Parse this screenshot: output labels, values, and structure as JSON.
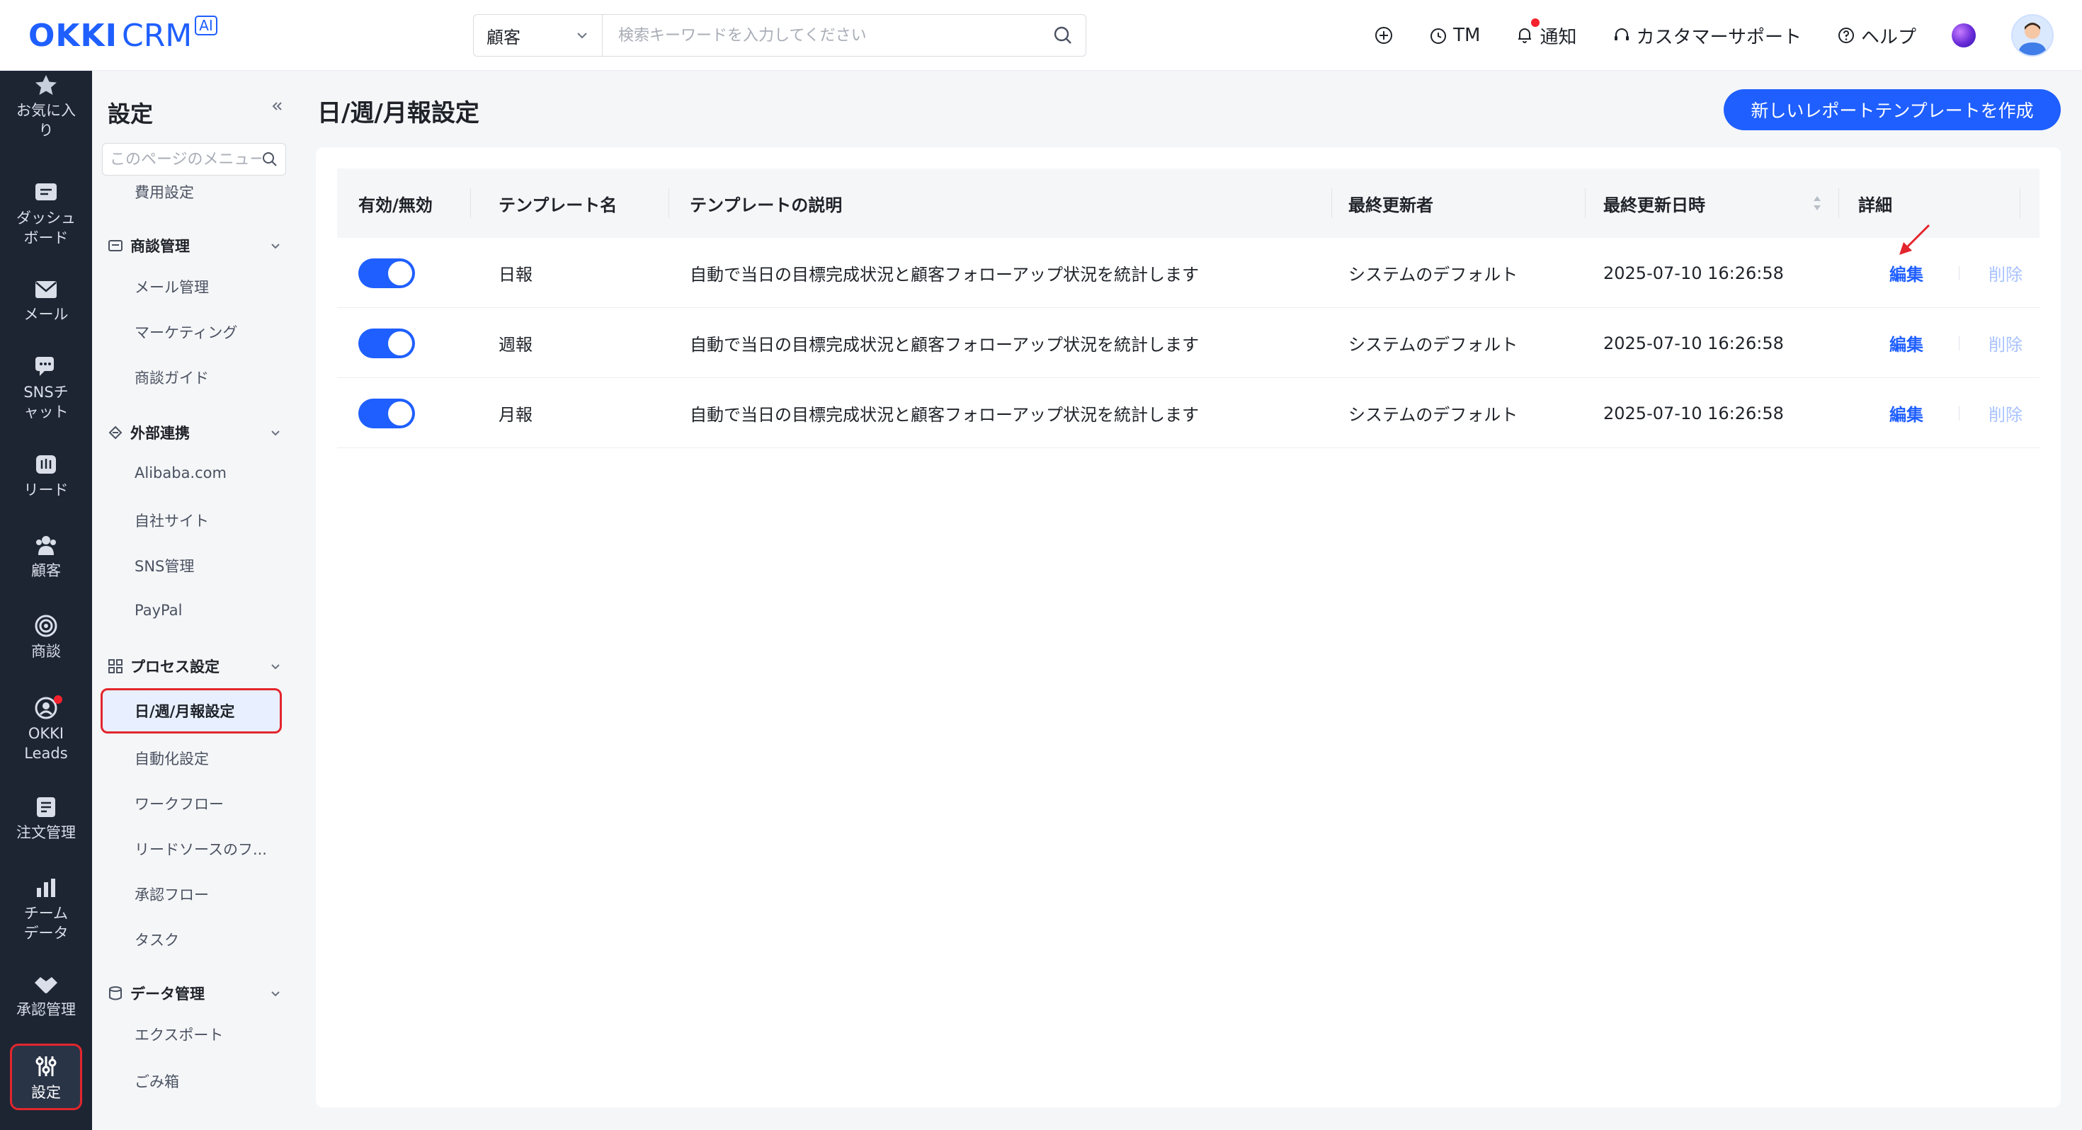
{
  "brand": {
    "logo_main": "OKKI",
    "logo_sub": "CRM",
    "logo_badge": "AI"
  },
  "search": {
    "type": "顧客",
    "placeholder": "検索キーワードを入力してください"
  },
  "top_actions": {
    "tm": "TM",
    "notify": "通知",
    "support": "カスタマーサポート",
    "help": "ヘルプ"
  },
  "leftnav": {
    "favorites": "お気に入り",
    "dashboard": "ダッシュボード",
    "mail": "メール",
    "sns_chat": "SNSチャット",
    "leads": "リード",
    "customers": "顧客",
    "deals": "商談",
    "okki_leads": "OKKI Leads",
    "orders": "注文管理",
    "team_data": "チームデータ",
    "approvals": "承認管理",
    "settings": "設定"
  },
  "sidebar": {
    "title": "設定",
    "search_placeholder": "このページのメニュー",
    "cost_settings": "費用設定",
    "groups": {
      "deals": "商談管理",
      "external": "外部連携",
      "process": "プロセス設定",
      "data": "データ管理"
    },
    "items": {
      "mail_mgmt": "メール管理",
      "marketing": "マーケティング",
      "deal_guide": "商談ガイド",
      "alibaba": "Alibaba.com",
      "own_site": "自社サイト",
      "sns_mgmt": "SNS管理",
      "paypal": "PayPal",
      "report_settings": "日/週/月報設定",
      "automation": "自動化設定",
      "workflow": "ワークフロー",
      "lead_source": "リードソースのフ...",
      "approval_flow": "承認フロー",
      "task": "タスク",
      "export": "エクスポート",
      "trash": "ごみ箱"
    }
  },
  "main": {
    "title": "日/週/月報設定",
    "create_button": "新しいレポートテンプレートを作成",
    "columns": {
      "enabled": "有効/無効",
      "name": "テンプレート名",
      "description": "テンプレートの説明",
      "updater": "最終更新者",
      "updated_at": "最終更新日時",
      "detail": "詳細"
    },
    "rows": [
      {
        "enabled": true,
        "name": "日報",
        "description": "自動で当日の目標完成状況と顧客フォローアップ状況を統計します",
        "updater": "システムのデフォルト",
        "updated_at": "2025-07-10 16:26:58",
        "edit": "編集",
        "delete": "削除"
      },
      {
        "enabled": true,
        "name": "週報",
        "description": "自動で当日の目標完成状況と顧客フォローアップ状況を統計します",
        "updater": "システムのデフォルト",
        "updated_at": "2025-07-10 16:26:58",
        "edit": "編集",
        "delete": "削除"
      },
      {
        "enabled": true,
        "name": "月報",
        "description": "自動で当日の目標完成状況と顧客フォローアップ状況を統計します",
        "updater": "システムのデフォルト",
        "updated_at": "2025-07-10 16:26:58",
        "edit": "編集",
        "delete": "削除"
      }
    ]
  },
  "colors": {
    "accent": "#1f5fff",
    "nav_bg": "#1d2533",
    "highlight": "#e3262d",
    "delete_muted": "#a9c3ff"
  }
}
